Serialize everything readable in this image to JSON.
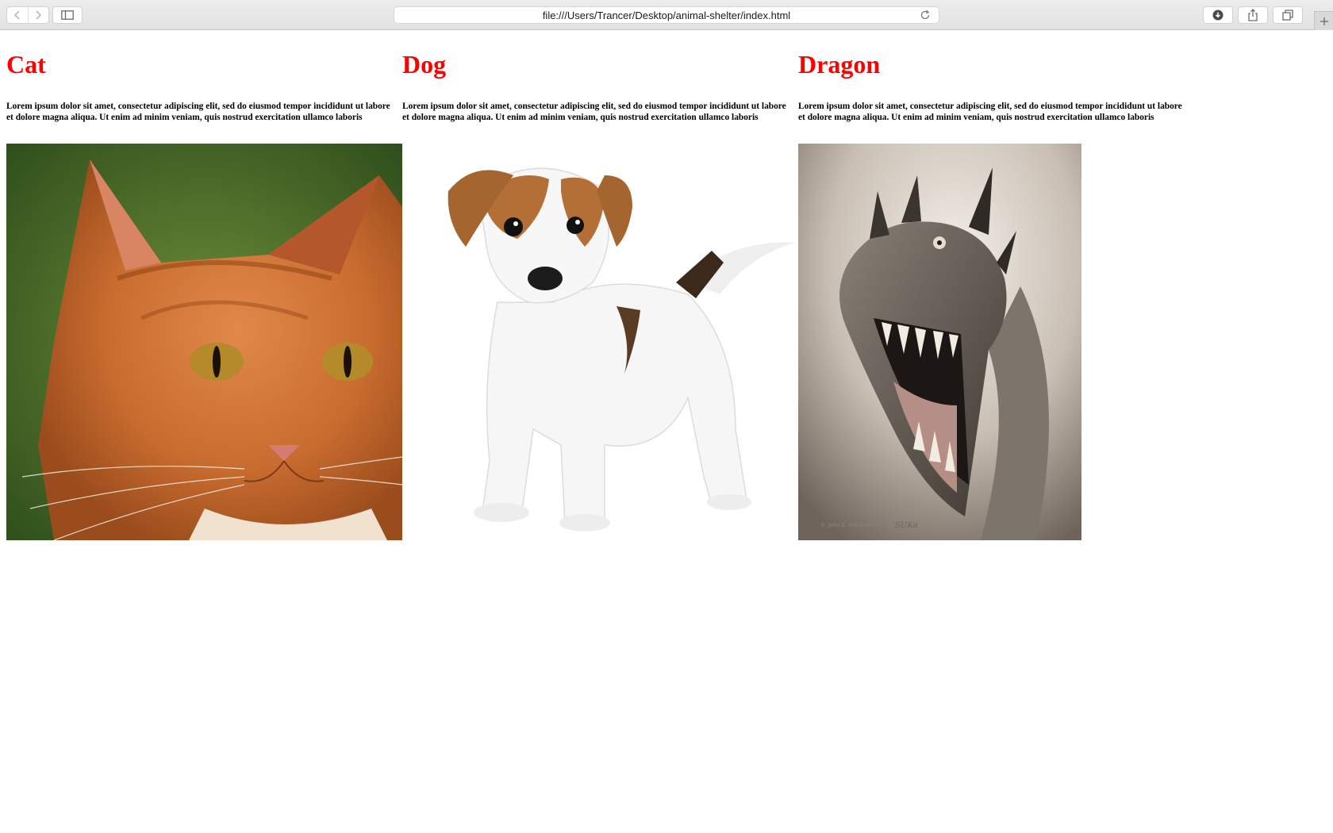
{
  "browser": {
    "url": "file:///Users/Trancer/Desktop/animal-shelter/index.html",
    "icons": {
      "back": "chevron-left-icon",
      "forward": "chevron-right-icon",
      "sidebar": "sidebar-icon",
      "reload": "reload-icon",
      "downloads": "download-icon",
      "share": "share-icon",
      "tabs": "tabs-overview-icon",
      "new_tab": "plus-icon"
    }
  },
  "animals": [
    {
      "name": "Cat",
      "description": "Lorem ipsum dolor sit amet, consectetur adipiscing elit, sed do eiusmod tempor incididunt ut labore et dolore magna aliqua. Ut enim ad minim veniam, quis nostrud exercitation ullamco laboris"
    },
    {
      "name": "Dog",
      "description": "Lorem ipsum dolor sit amet, consectetur adipiscing elit, sed do eiusmod tempor incididunt ut labore et dolore magna aliqua. Ut enim ad minim veniam, quis nostrud exercitation ullamco laboris"
    },
    {
      "name": "Dragon",
      "description": "Lorem ipsum dolor sit amet, consectetur adipiscing elit, sed do eiusmod tempor incididunt ut labore et dolore magna aliqua. Ut enim ad minim veniam, quis nostrud exercitation ullamco laboris"
    }
  ],
  "colors": {
    "heading": "#ff0000",
    "text": "#000000",
    "background": "#ffffff"
  }
}
